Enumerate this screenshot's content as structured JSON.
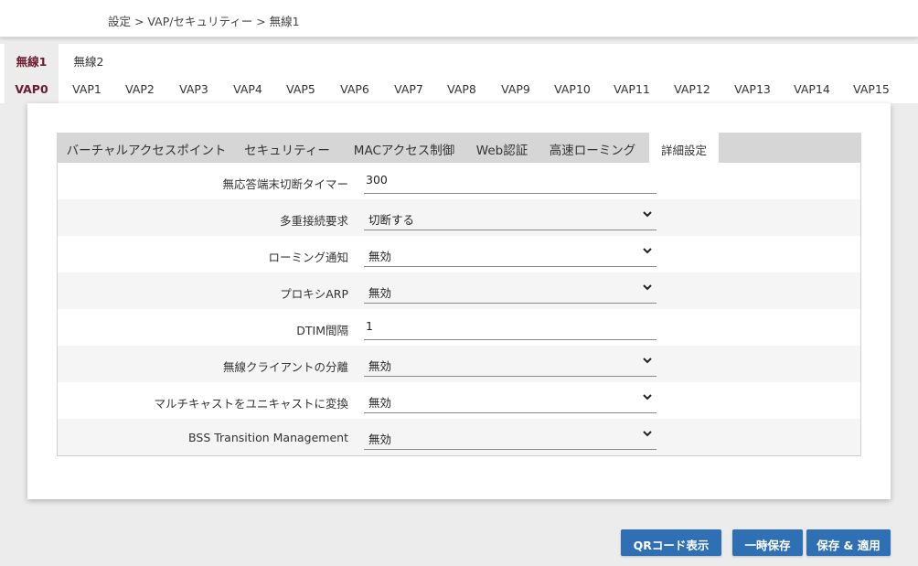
{
  "breadcrumb": "設定 > VAP/セキュリティー > 無線1",
  "radio_tabs": [
    "無線1",
    "無線2"
  ],
  "vap_tabs": [
    "VAP0",
    "VAP1",
    "VAP2",
    "VAP3",
    "VAP4",
    "VAP5",
    "VAP6",
    "VAP7",
    "VAP8",
    "VAP9",
    "VAP10",
    "VAP11",
    "VAP12",
    "VAP13",
    "VAP14",
    "VAP15"
  ],
  "sub_tabs": [
    "バーチャルアクセスポイント",
    "セキュリティー",
    "MACアクセス制御",
    "Web認証",
    "高速ローミング",
    "詳細設定"
  ],
  "form": {
    "rows": [
      {
        "label": "無応答端末切断タイマー",
        "value": "300"
      },
      {
        "label": "多重接続要求",
        "value": "切断する"
      },
      {
        "label": "ローミング通知",
        "value": "無効"
      },
      {
        "label": "プロキシARP",
        "value": "無効"
      },
      {
        "label": "DTIM間隔",
        "value": "1"
      },
      {
        "label": "無線クライアントの分離",
        "value": "無効"
      },
      {
        "label": "マルチキャストをユニキャストに変換",
        "value": "無効"
      },
      {
        "label": "BSS Transition Management",
        "value": "無効"
      }
    ]
  },
  "buttons": {
    "qr": "QRコード表示",
    "temp_save": "一時保存",
    "save_apply": "保存 & 適用"
  },
  "colors": {
    "accent": "#6b1c2e",
    "button": "#2f6fb3"
  }
}
